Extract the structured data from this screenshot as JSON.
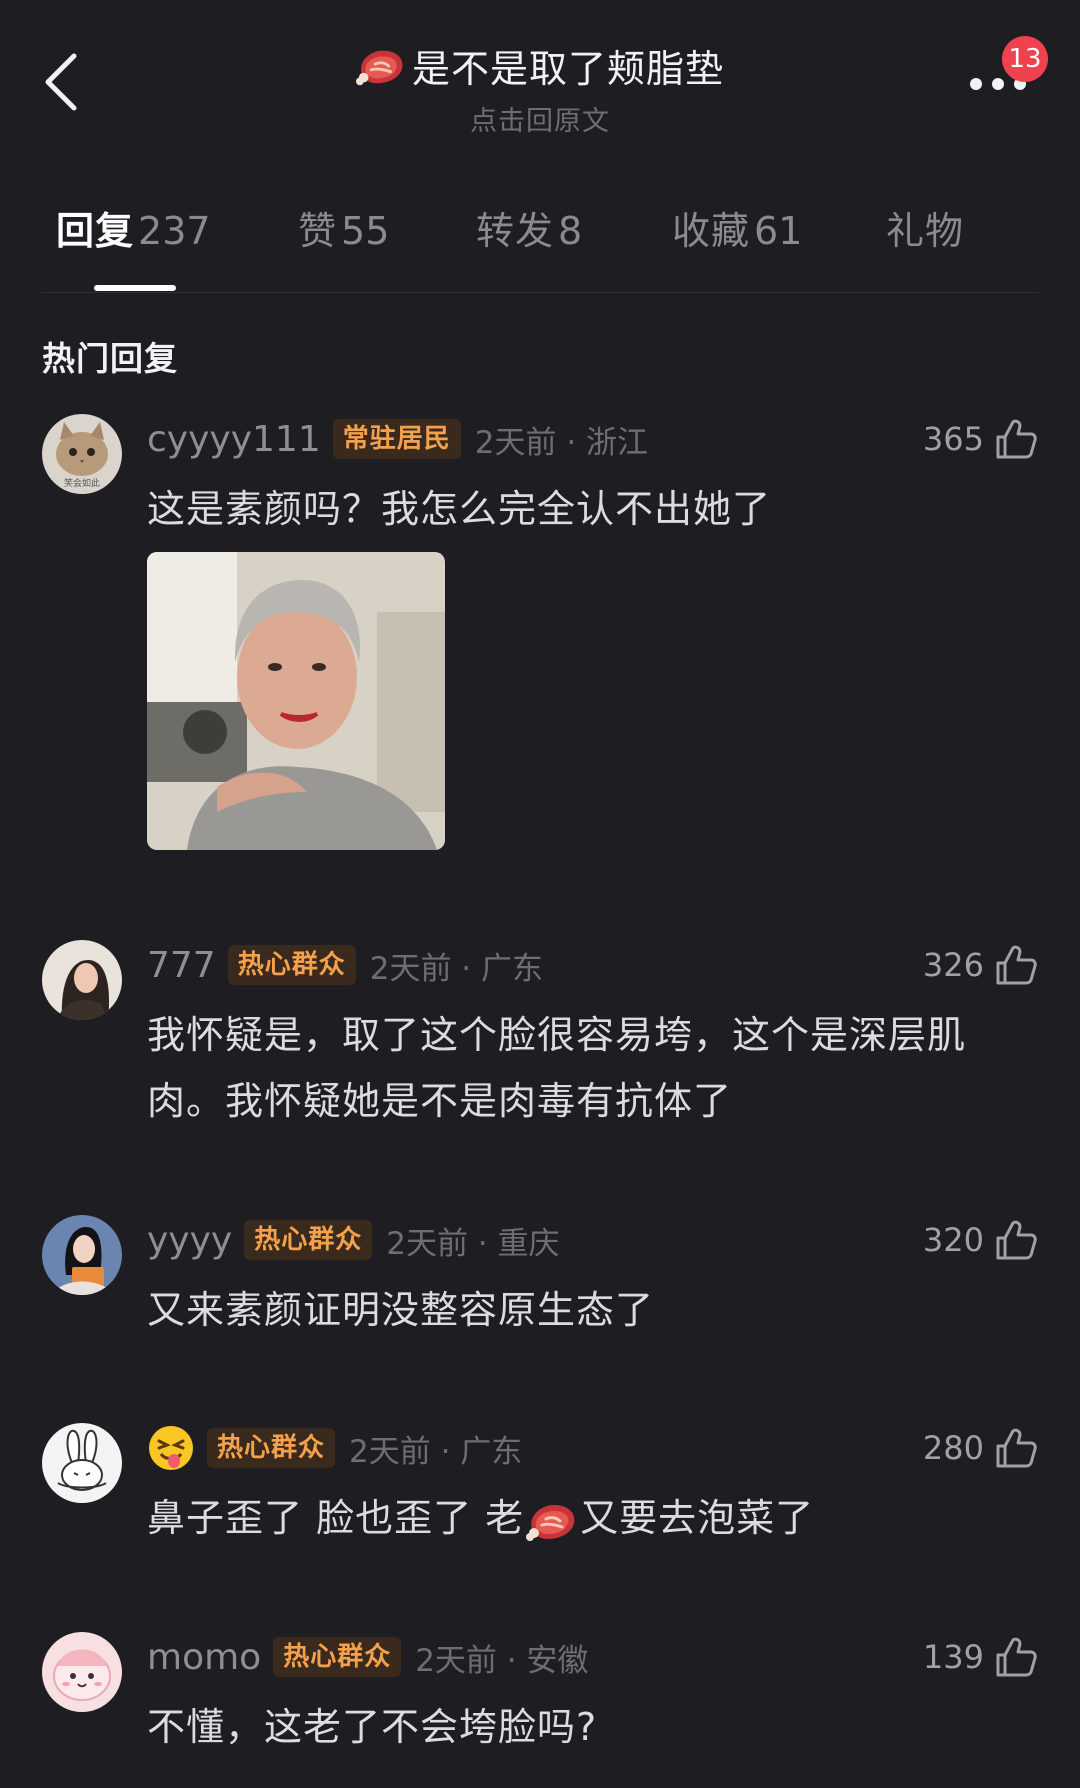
{
  "header": {
    "title": "是不是取了颊脂垫",
    "subtitle": "点击回原文",
    "notification_count": "13"
  },
  "tabs": [
    {
      "label": "回复",
      "count": "237"
    },
    {
      "label": "赞",
      "count": "55"
    },
    {
      "label": "转发",
      "count": "8"
    },
    {
      "label": "收藏",
      "count": "61"
    },
    {
      "label": "礼物",
      "count": ""
    }
  ],
  "section_title": "热门回复",
  "comments": [
    {
      "username": "cyyyy111",
      "badge": "常驻居民",
      "time_location": "2天前 · 浙江",
      "likes": "365",
      "text": "这是素颜吗？我怎么完全认不出她了",
      "avatar_caption": "笑会如此"
    },
    {
      "username": "777",
      "badge": "热心群众",
      "time_location": "2天前 · 广东",
      "likes": "326",
      "text": "我怀疑是，取了这个脸很容易垮，这个是深层肌肉。我怀疑她是不是肉毒有抗体了"
    },
    {
      "username": "yyyy",
      "badge": "热心群众",
      "time_location": "2天前 · 重庆",
      "likes": "320",
      "text": "又来素颜证明没整容原生态了"
    },
    {
      "username": "",
      "badge": "热心群众",
      "time_location": "2天前 · 广东",
      "likes": "280",
      "text_before": "鼻子歪了 脸也歪了 老",
      "text_after": "又要去泡菜了"
    },
    {
      "username": "momo",
      "badge": "热心群众",
      "time_location": "2天前 · 安徽",
      "likes": "139",
      "text": "不懂，这老了不会垮脸吗?"
    }
  ],
  "colors": {
    "background": "#1d1d22",
    "badge_text": "#f5a14b",
    "notification": "#f0424e"
  },
  "icons": {
    "back": "chevron-left-icon",
    "more": "ellipsis-icon",
    "like": "thumbs-up-icon",
    "title": "meat-icon"
  }
}
